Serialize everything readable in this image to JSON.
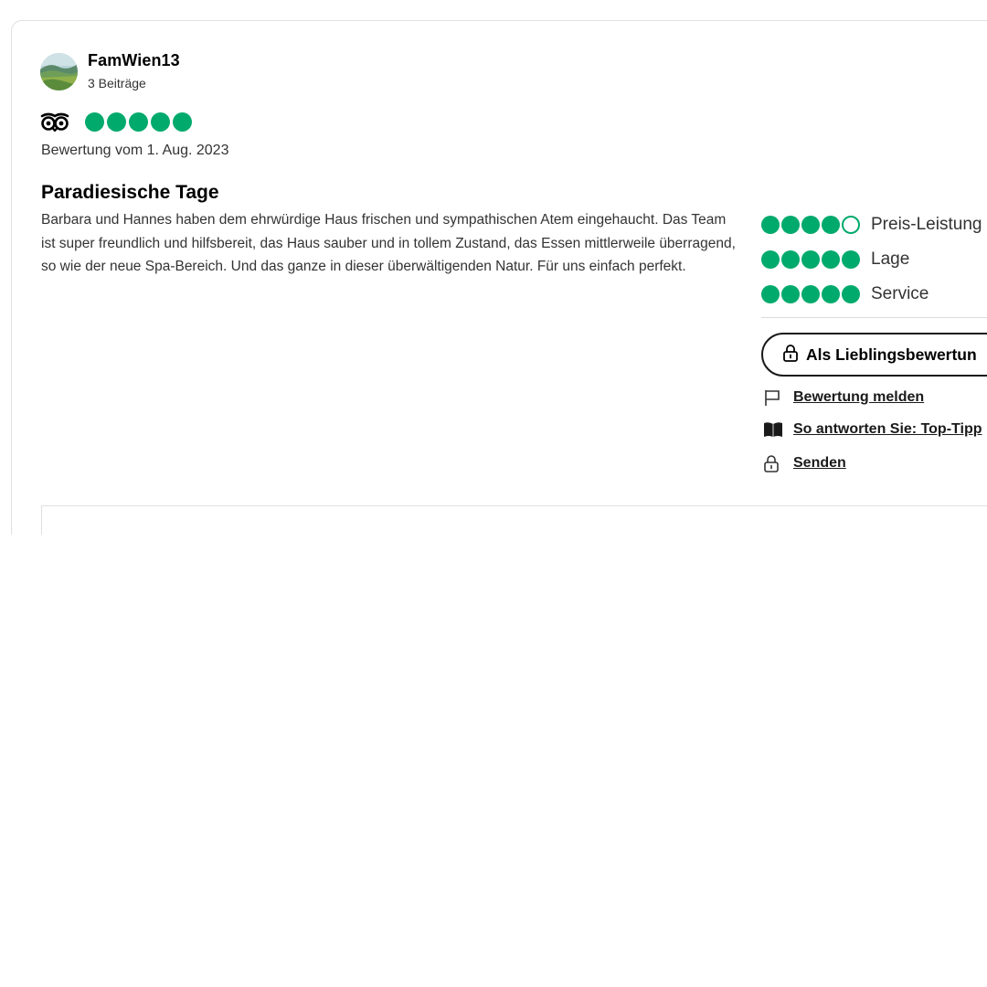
{
  "user": {
    "name": "FamWien13",
    "contributions": "3 Beiträge",
    "avatar_icon": "landscape-avatar-icon"
  },
  "review": {
    "rating": 5,
    "rating_max": 5,
    "date": "Bewertung vom 1. Aug. 2023",
    "title": "Paradiesische Tage",
    "text": "Barbara und Hannes haben dem ehrwürdige Haus frischen und sympathischen Atem eingehaucht. Das Team ist super freundlich und hilfsbereit, das Haus sauber und in tollem Zustand, das Essen mittlerweile überragend, so wie der neue Spa-Bereich. Und das ganze in dieser überwältigenden Natur. Für uns einfach perfekt."
  },
  "sub_ratings": [
    {
      "label": "Preis-Leistung",
      "rating": 4
    },
    {
      "label": "Lage",
      "rating": 5
    },
    {
      "label": "Service",
      "rating": 5
    }
  ],
  "actions": {
    "favorite_label": "Als Lieblingsbewertun",
    "report_label": "Bewertung melden",
    "tips_label": "So antworten Sie: Top-Tipp",
    "send_label": "Senden"
  },
  "colors": {
    "bubble": "#00aa6c",
    "text": "#333333",
    "border": "#e0e0e0"
  }
}
